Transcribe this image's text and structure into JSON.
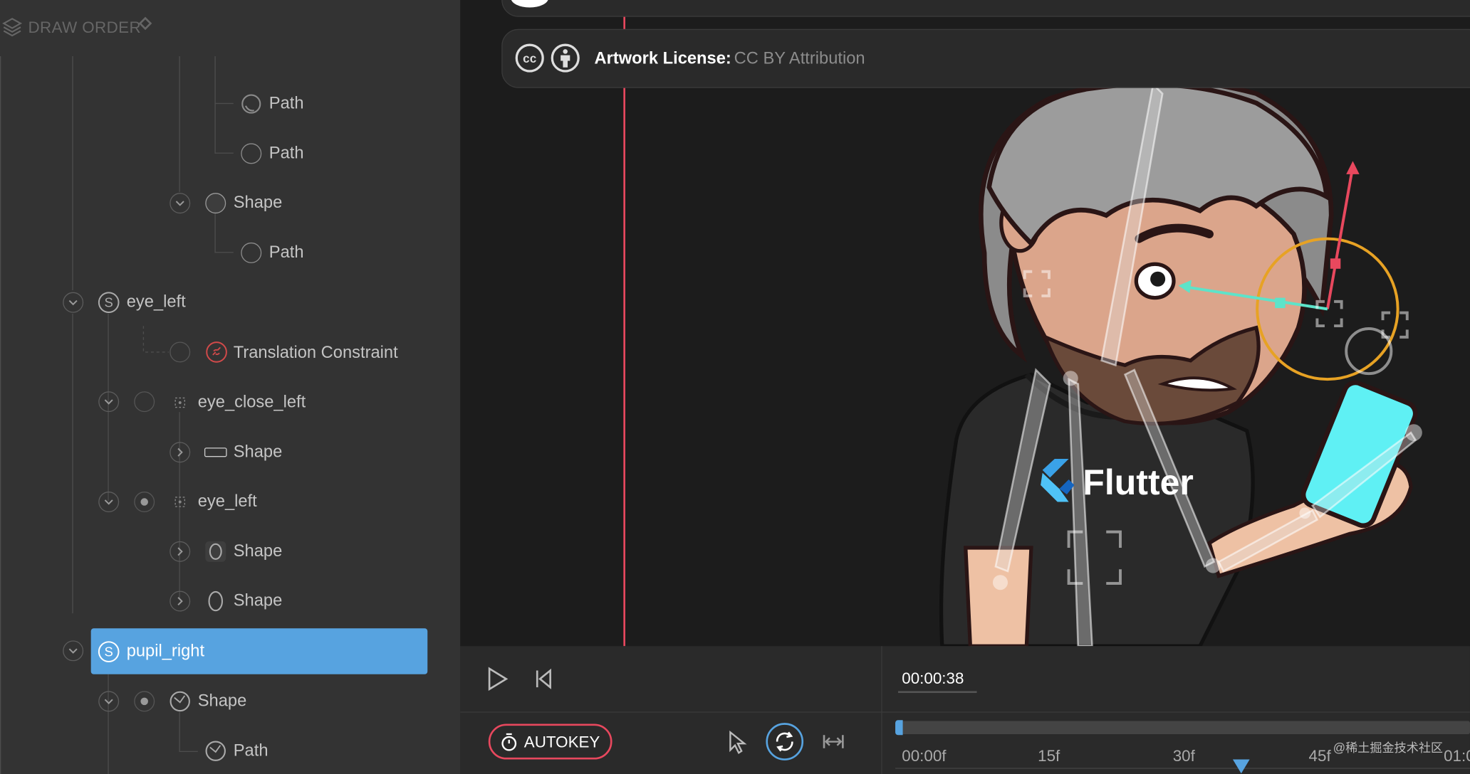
{
  "panel": {
    "header": "DRAW ORDER",
    "tree": [
      {
        "label": "Path"
      },
      {
        "label": "Path"
      },
      {
        "label": "Shape"
      },
      {
        "label": "Path"
      },
      {
        "label": "eye_left"
      },
      {
        "label": "Translation Constraint"
      },
      {
        "label": "eye_close_left"
      },
      {
        "label": "Shape"
      },
      {
        "label": "eye_left"
      },
      {
        "label": "Shape"
      },
      {
        "label": "Shape"
      },
      {
        "label": "pupil_right"
      },
      {
        "label": "Shape"
      },
      {
        "label": "Path"
      }
    ]
  },
  "license": {
    "label": "Artwork License:",
    "value": "CC BY Attribution",
    "cc_text": "cc"
  },
  "canvas": {
    "logo_text": "Flutter"
  },
  "timeline": {
    "current_time": "00:00:38",
    "autokey_label": "AUTOKEY",
    "ruler_ticks": [
      "00:00f",
      "15f",
      "30f",
      "45f",
      "01:0"
    ],
    "playhead_frame": 38
  },
  "watermark": "@稀土掘金技术社区",
  "colors": {
    "accent": "#57a3e0",
    "red": "#e8485e",
    "panel": "#333333",
    "canvas": "#1c1c1c",
    "orange": "#e7a224",
    "teal": "#5de3c9",
    "phone": "#5ff0f4"
  }
}
